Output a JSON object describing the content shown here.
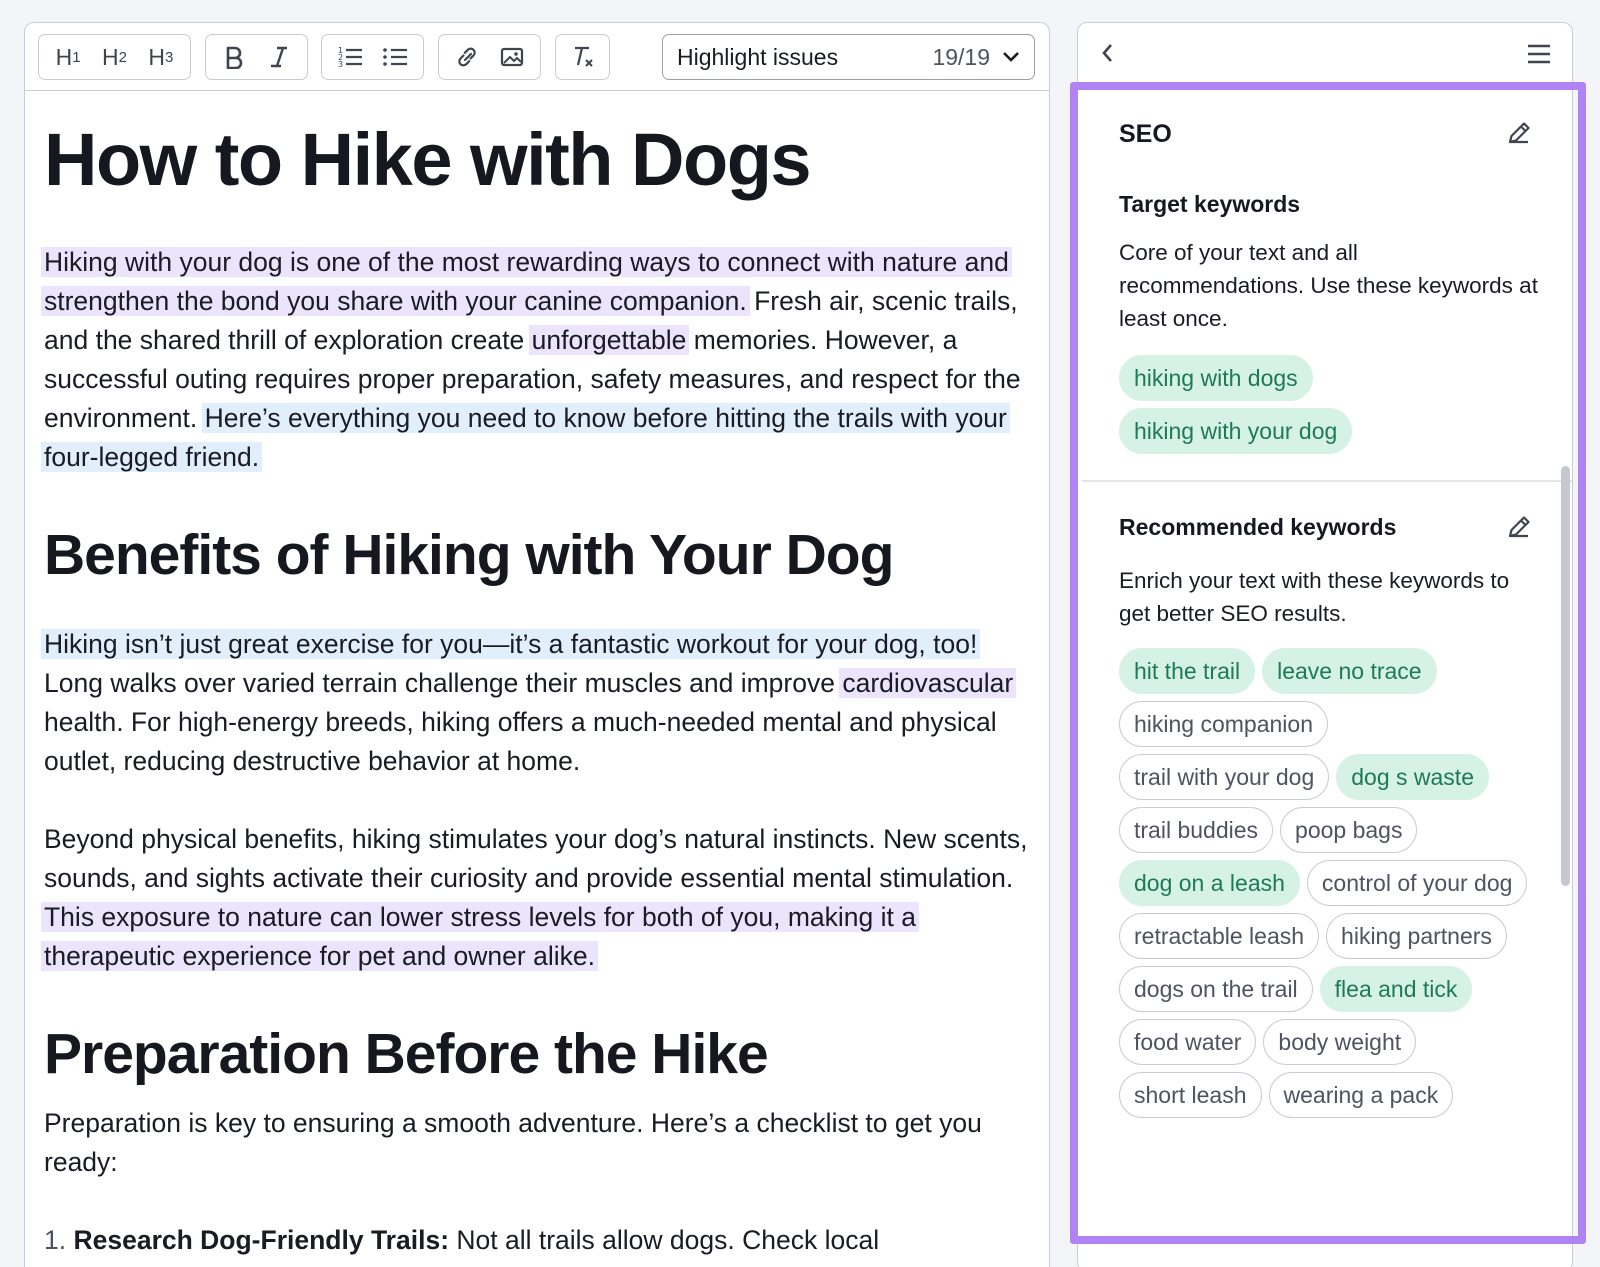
{
  "toolbar": {
    "h1": "H",
    "h1_sub": "1",
    "h2": "H",
    "h2_sub": "2",
    "h3": "H",
    "h3_sub": "3",
    "highlight_label": "Highlight issues",
    "highlight_count": "19/19"
  },
  "document": {
    "title": "How to Hike with Dogs",
    "p1_hl1": "Hiking with your dog is one of the most rewarding ways to connect with nature and strengthen the bond you share with your canine companion.",
    "p1_t1": " Fresh air, scenic trails, and the shared thrill of exploration create ",
    "p1_hl2": "unforgettable",
    "p1_t2": " memories. However, a successful outing requires proper preparation, safety measures, and respect for the environment. ",
    "p1_hl3": "Here’s everything you need to know before hitting the trails with your four-legged friend.",
    "h2_benefits": "Benefits of Hiking with Your Dog",
    "p2_hl1": "Hiking isn’t just great exercise for you—it’s a fantastic workout for your dog, too!",
    "p2_t1": " Long walks over varied terrain challenge their muscles and improve ",
    "p2_hl2": "cardiovascular",
    "p2_t2": " health. For high-energy breeds, hiking offers a much-needed mental and physical outlet, reducing destructive behavior at home.",
    "p3_t1": "Beyond physical benefits, hiking stimulates your dog’s natural instincts. New scents, sounds, and sights activate their curiosity and provide essential mental stimulation. ",
    "p3_hl1": "This exposure to nature can lower stress levels for both of you, making it a therapeutic experience for pet and owner alike.",
    "h2_prep": "Preparation Before the Hike",
    "p4": "Preparation is key to ensuring a smooth adventure. Here’s a checklist to get you ready:",
    "list_num": "1.",
    "list_bold": "Research Dog-Friendly Trails:",
    "list_text": " Not all trails allow dogs. Check local"
  },
  "seo": {
    "title": "SEO",
    "target_title": "Target keywords",
    "target_desc": "Core of your text and all recommendations. Use these keywords at least once.",
    "target_keywords": [
      "hiking with dogs",
      "hiking with your dog"
    ],
    "recommended_title": "Recommended keywords",
    "recommended_desc": "Enrich your text with these keywords to get better SEO results.",
    "recommended_keywords": [
      {
        "text": "hit the trail",
        "used": true
      },
      {
        "text": "leave no trace",
        "used": true
      },
      {
        "text": "hiking companion",
        "used": false
      },
      {
        "text": "trail with your dog",
        "used": false
      },
      {
        "text": "dog s waste",
        "used": true
      },
      {
        "text": "trail buddies",
        "used": false
      },
      {
        "text": "poop bags",
        "used": false
      },
      {
        "text": "dog on a leash",
        "used": true
      },
      {
        "text": "control of your dog",
        "used": false
      },
      {
        "text": "retractable leash",
        "used": false
      },
      {
        "text": "hiking partners",
        "used": false
      },
      {
        "text": "dogs on the trail",
        "used": false
      },
      {
        "text": "flea and tick",
        "used": true
      },
      {
        "text": "food water",
        "used": false
      },
      {
        "text": "body weight",
        "used": false
      },
      {
        "text": "short leash",
        "used": false
      },
      {
        "text": "wearing a pack",
        "used": false
      }
    ]
  },
  "colors": {
    "highlight_purple": "#ece3fd",
    "highlight_blue": "#e1eefc",
    "chip_used_bg": "#d6f2e6",
    "chip_used_text": "#1d7a55",
    "frame_purple": "#b184f6"
  },
  "icons": [
    "bold-icon",
    "italic-icon",
    "ordered-list-icon",
    "bullet-list-icon",
    "link-icon",
    "image-icon",
    "clear-format-icon",
    "chevron-down-icon",
    "chevron-left-icon",
    "menu-icon",
    "pencil-icon"
  ]
}
